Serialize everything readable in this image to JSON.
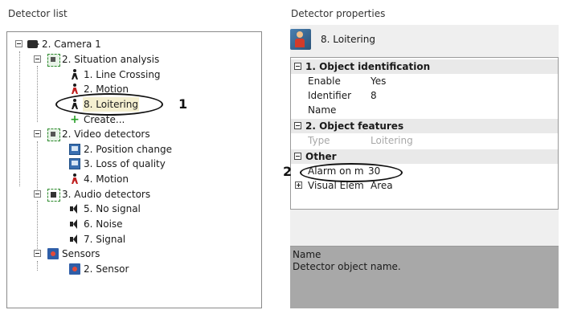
{
  "left_panel": {
    "title": "Detector list",
    "tree": [
      {
        "label": "2. Camera 1",
        "icon": "camera-icon"
      },
      {
        "label": "2. Situation analysis",
        "icon": "group-icon"
      },
      {
        "label": "1. Line Crossing",
        "icon": "person-icon"
      },
      {
        "label": "2. Motion",
        "icon": "person-icon"
      },
      {
        "label": "8. Loitering",
        "icon": "person-icon",
        "selected": true
      },
      {
        "label": "Create...",
        "icon": "plus-icon"
      },
      {
        "label": "2. Video detectors",
        "icon": "group-icon"
      },
      {
        "label": "2. Position change",
        "icon": "monitor-icon"
      },
      {
        "label": "3. Loss of quality",
        "icon": "monitor-icon"
      },
      {
        "label": "4. Motion",
        "icon": "person-icon"
      },
      {
        "label": "3. Audio detectors",
        "icon": "audio-group-icon"
      },
      {
        "label": "5. No signal",
        "icon": "speaker-icon"
      },
      {
        "label": "6. Noise",
        "icon": "speaker-icon"
      },
      {
        "label": "7. Signal",
        "icon": "speaker-icon"
      },
      {
        "label": "Sensors",
        "icon": "sensor-icon"
      },
      {
        "label": "2. Sensor",
        "icon": "sensor-icon"
      }
    ]
  },
  "right_panel": {
    "title": "Detector properties",
    "detector_title": "8. Loitering",
    "properties": {
      "cat1": "1. Object identification",
      "enable_label": "Enable",
      "enable_value": "Yes",
      "identifier_label": "Identifier",
      "identifier_value": "8",
      "name_label": "Name",
      "cat2": "2. Object features",
      "type_label": "Type",
      "type_value": "Loitering",
      "cat3": "Other",
      "alarm_label": "Alarm on m",
      "alarm_value": "30",
      "visual_label": "Visual Elem",
      "visual_value": "Area"
    },
    "description": {
      "title": "Name",
      "text": "Detector object name."
    }
  },
  "callouts": {
    "one": "1",
    "two": "2"
  },
  "colors": {
    "selected_bg": "#f4efd0",
    "description_bg": "#a8a8a8",
    "accent_green": "#2aa02a"
  }
}
